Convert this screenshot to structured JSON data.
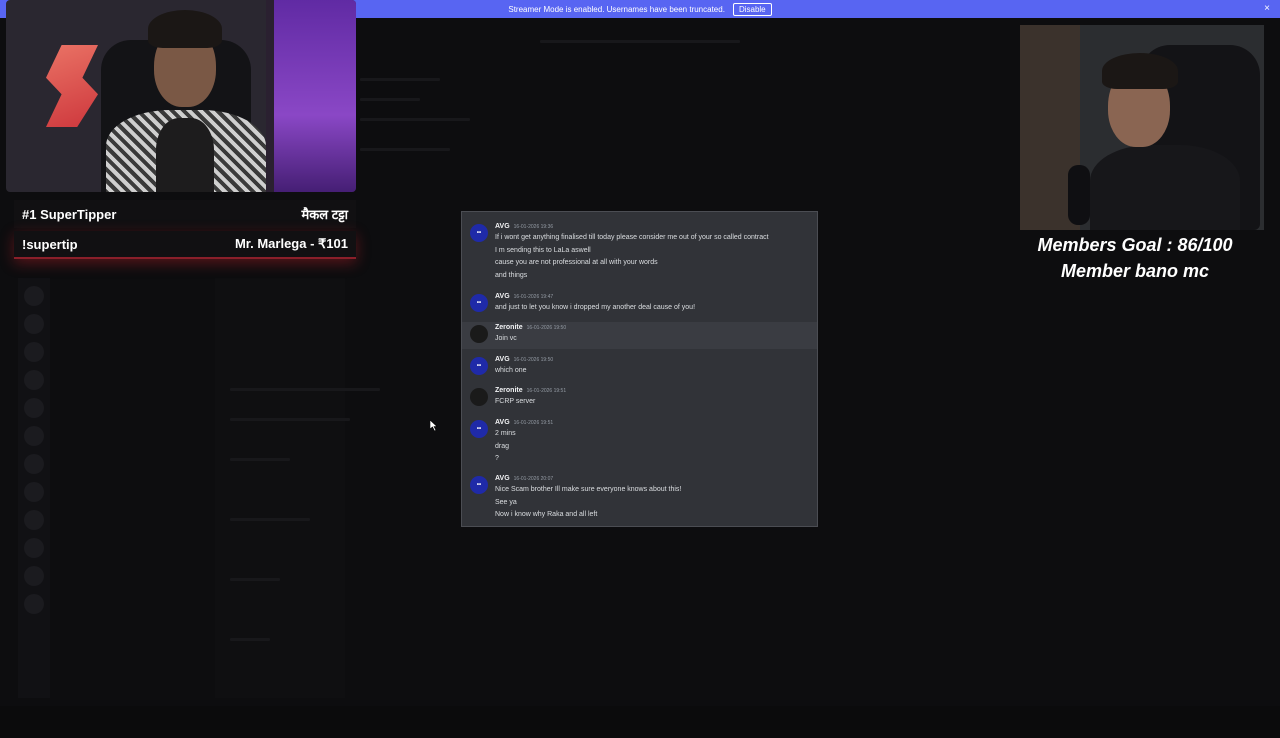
{
  "banner": {
    "text": "Streamer Mode is enabled. Usernames have been truncated.",
    "disable_label": "Disable",
    "close_icon": "×"
  },
  "tipper": {
    "rank_label": "#1 SuperTipper",
    "rank_name": "मैकल टट्टा",
    "command": "!supertip",
    "latest": "Mr. Marlega - ₹101"
  },
  "goal": {
    "line1": "Members Goal : 86/100",
    "line2": "Member bano mc"
  },
  "chat": {
    "messages": [
      {
        "user": "AVG",
        "time": "16-01-2026 19:36",
        "avatar": "avg",
        "lines": [
          "If i wont get anything finalised till today please consider me out of your so called contract",
          "I m sending this to LaLa aswell",
          "cause you are not professional at all with your words",
          "and things"
        ]
      },
      {
        "user": "AVG",
        "time": "16-01-2026 19:47",
        "avatar": "avg",
        "lines": [
          "and just to let you know i dropped my another deal cause of you!"
        ]
      },
      {
        "user": "Zeronite",
        "time": "16-01-2026 19:50",
        "avatar": "zeronite",
        "highlight": true,
        "lines": [
          "Join vc"
        ]
      },
      {
        "user": "AVG",
        "time": "16-01-2026 19:50",
        "avatar": "avg",
        "lines": [
          "which one"
        ]
      },
      {
        "user": "Zeronite",
        "time": "16-01-2026 19:51",
        "avatar": "zeronite",
        "lines": [
          "FCRP server"
        ]
      },
      {
        "user": "AVG",
        "time": "16-01-2026 19:51",
        "avatar": "avg",
        "lines": [
          "2 mins",
          "drag",
          "?"
        ]
      },
      {
        "user": "AVG",
        "time": "16-01-2026 20:07",
        "avatar": "avg",
        "lines": [
          "Nice Scam brother Ill make sure everyone knows about this!",
          "See ya",
          "Now i know why Raka and all left"
        ]
      }
    ]
  }
}
